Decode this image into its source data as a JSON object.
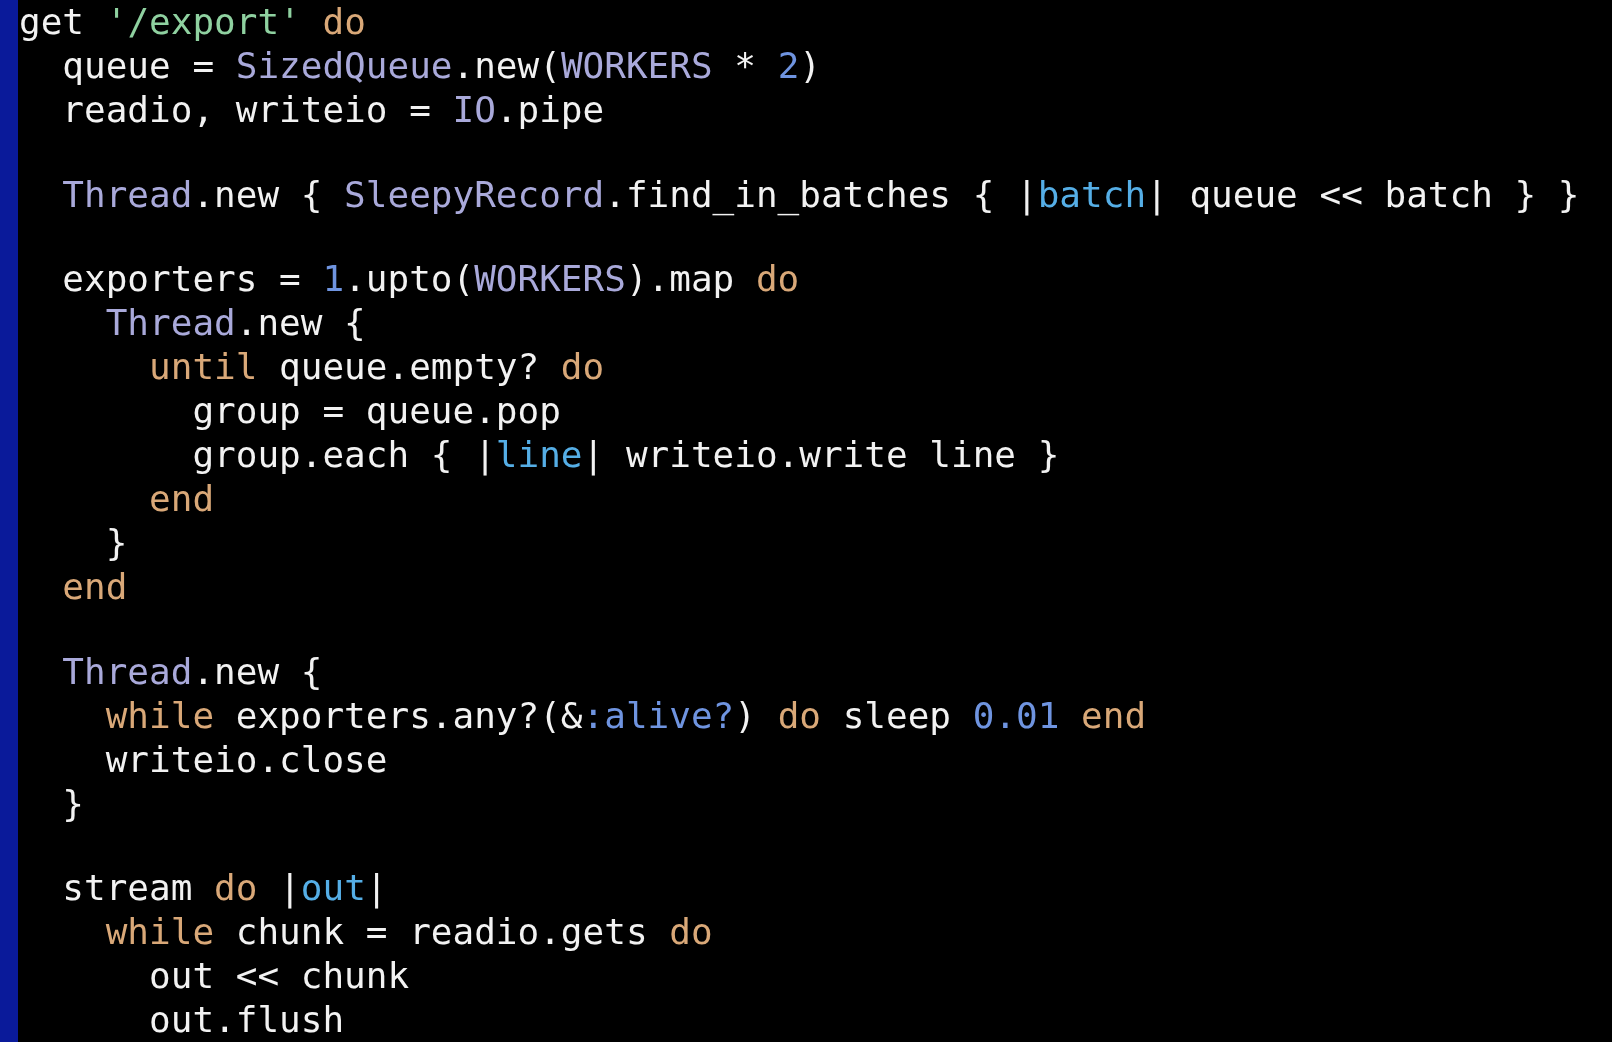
{
  "editor": {
    "lines": [
      {
        "kind": "code",
        "tokens": [
          {
            "kind": "plain",
            "text": "get "
          },
          {
            "kind": "string",
            "text": "'/export'"
          },
          {
            "kind": "keyword",
            "text": " do"
          }
        ]
      },
      {
        "kind": "code",
        "tokens": [
          {
            "kind": "plain",
            "text": "  queue = "
          },
          {
            "kind": "constant",
            "text": "SizedQueue"
          },
          {
            "kind": "plain",
            "text": ".new("
          },
          {
            "kind": "constant",
            "text": "WORKERS"
          },
          {
            "kind": "plain",
            "text": " * "
          },
          {
            "kind": "number",
            "text": "2"
          },
          {
            "kind": "plain",
            "text": ")"
          }
        ]
      },
      {
        "kind": "code",
        "tokens": [
          {
            "kind": "plain",
            "text": "  readio, writeio = "
          },
          {
            "kind": "constant",
            "text": "IO"
          },
          {
            "kind": "plain",
            "text": ".pipe"
          }
        ]
      },
      {
        "kind": "blank"
      },
      {
        "kind": "code",
        "tokens": [
          {
            "kind": "constant",
            "text": "  Thread"
          },
          {
            "kind": "plain",
            "text": ".new { "
          },
          {
            "kind": "constant",
            "text": "SleepyRecord"
          },
          {
            "kind": "plain",
            "text": ".find_in_batches { |"
          },
          {
            "kind": "param",
            "text": "batch"
          },
          {
            "kind": "plain",
            "text": "| queue << batch } }"
          }
        ]
      },
      {
        "kind": "blank"
      },
      {
        "kind": "code",
        "tokens": [
          {
            "kind": "plain",
            "text": "  exporters = "
          },
          {
            "kind": "number",
            "text": "1"
          },
          {
            "kind": "plain",
            "text": ".upto("
          },
          {
            "kind": "constant",
            "text": "WORKERS"
          },
          {
            "kind": "plain",
            "text": ").map "
          },
          {
            "kind": "keyword",
            "text": "do"
          }
        ]
      },
      {
        "kind": "code",
        "tokens": [
          {
            "kind": "constant",
            "text": "    Thread"
          },
          {
            "kind": "plain",
            "text": ".new {"
          }
        ]
      },
      {
        "kind": "code",
        "tokens": [
          {
            "kind": "keyword",
            "text": "      until"
          },
          {
            "kind": "plain",
            "text": " queue.empty? "
          },
          {
            "kind": "keyword",
            "text": "do"
          }
        ]
      },
      {
        "kind": "code",
        "tokens": [
          {
            "kind": "plain",
            "text": "        group = queue.pop"
          }
        ]
      },
      {
        "kind": "code",
        "tokens": [
          {
            "kind": "plain",
            "text": "        group.each { |"
          },
          {
            "kind": "param",
            "text": "line"
          },
          {
            "kind": "plain",
            "text": "| writeio.write line }"
          }
        ]
      },
      {
        "kind": "code",
        "tokens": [
          {
            "kind": "keyword",
            "text": "      end"
          }
        ]
      },
      {
        "kind": "code",
        "tokens": [
          {
            "kind": "plain",
            "text": "    }"
          }
        ]
      },
      {
        "kind": "code",
        "tokens": [
          {
            "kind": "keyword",
            "text": "  end"
          }
        ]
      },
      {
        "kind": "blank"
      },
      {
        "kind": "code",
        "tokens": [
          {
            "kind": "constant",
            "text": "  Thread"
          },
          {
            "kind": "plain",
            "text": ".new {"
          }
        ]
      },
      {
        "kind": "code",
        "tokens": [
          {
            "kind": "keyword",
            "text": "    while"
          },
          {
            "kind": "plain",
            "text": " exporters.any?(&"
          },
          {
            "kind": "symbol",
            "text": ":alive?"
          },
          {
            "kind": "plain",
            "text": ") "
          },
          {
            "kind": "keyword",
            "text": "do"
          },
          {
            "kind": "plain",
            "text": " sleep "
          },
          {
            "kind": "number",
            "text": "0.01"
          },
          {
            "kind": "keyword",
            "text": " end"
          }
        ]
      },
      {
        "kind": "code",
        "tokens": [
          {
            "kind": "plain",
            "text": "    writeio.close"
          }
        ]
      },
      {
        "kind": "code",
        "tokens": [
          {
            "kind": "plain",
            "text": "  }"
          }
        ]
      },
      {
        "kind": "blank"
      },
      {
        "kind": "code",
        "tokens": [
          {
            "kind": "plain",
            "text": "  stream "
          },
          {
            "kind": "keyword",
            "text": "do"
          },
          {
            "kind": "plain",
            "text": " |"
          },
          {
            "kind": "param",
            "text": "out"
          },
          {
            "kind": "plain",
            "text": "|"
          }
        ]
      },
      {
        "kind": "code",
        "tokens": [
          {
            "kind": "keyword",
            "text": "    while"
          },
          {
            "kind": "plain",
            "text": " chunk = readio.gets "
          },
          {
            "kind": "keyword",
            "text": "do"
          }
        ]
      },
      {
        "kind": "code",
        "tokens": [
          {
            "kind": "plain",
            "text": "      out << chunk"
          }
        ]
      },
      {
        "kind": "code",
        "tokens": [
          {
            "kind": "plain",
            "text": "      out.flush"
          }
        ]
      }
    ]
  }
}
